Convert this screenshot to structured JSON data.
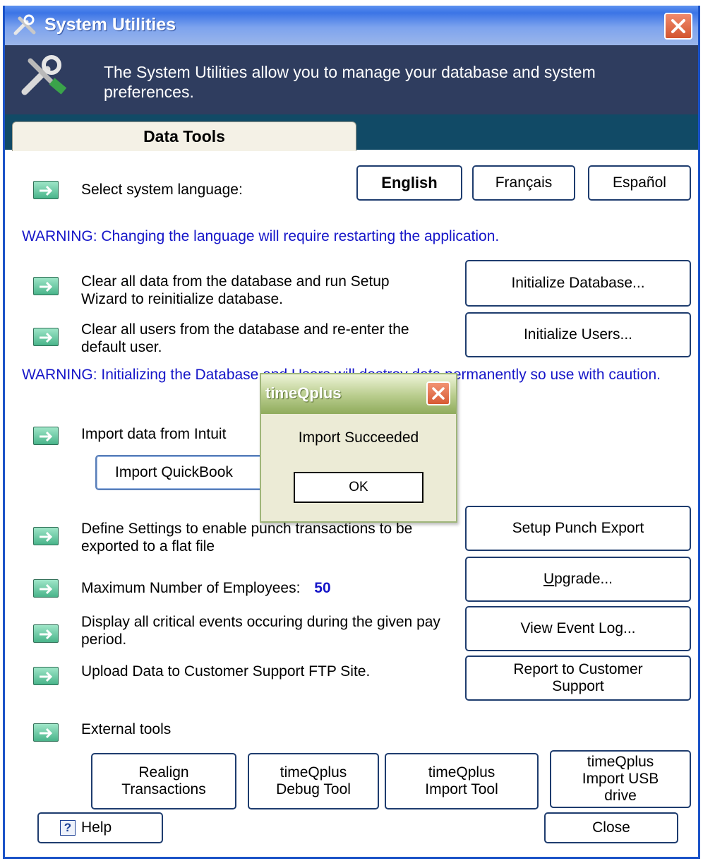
{
  "window": {
    "title": "System Utilities",
    "description": "The System Utilities allow you to manage your database and system preferences."
  },
  "tabs": [
    {
      "label": "Data Tools",
      "active": true
    }
  ],
  "language": {
    "label": "Select system language:",
    "options": [
      "English",
      "Français",
      "Español"
    ],
    "selected": "English"
  },
  "warnings": {
    "language": "WARNING:  Changing the language will require restarting the application.",
    "database": "WARNING:  Initializing the Database and Users will destroy data permanently so use with caution."
  },
  "rows": {
    "clear_data": "Clear all data from the database and run Setup Wizard to reinitialize database.",
    "clear_users": "Clear all users from the  database and re-enter the default user.",
    "import_intuit": "Import data from Intuit",
    "punch_export": "Define Settings to enable punch transactions to be exported to a flat file",
    "max_employees_label": "Maximum Number of Employees:",
    "max_employees_value": "50",
    "critical_events": "Display all critical events occuring during the given pay period.",
    "upload_ftp": "Upload Data to Customer Support FTP Site.",
    "external_tools": "External tools"
  },
  "buttons": {
    "initialize_database": "Initialize Database...",
    "initialize_users": "Initialize Users...",
    "import_quickbooks": "Import QuickBook",
    "setup_punch_export": "Setup Punch Export",
    "upgrade_prefix": "",
    "upgrade_key": "U",
    "upgrade_rest": "pgrade...",
    "view_event_log": "View Event Log...",
    "report_to_support": "Report to Customer Support",
    "realign": "Realign Transactions",
    "debug_tool": "timeQplus Debug Tool",
    "import_tool": "timeQplus Import Tool",
    "import_usb": "timeQplus Import USB drive",
    "help": "Help",
    "close": "Close"
  },
  "dialog": {
    "title": "timeQplus",
    "message": "Import Succeeded",
    "ok": "OK"
  },
  "colors": {
    "titlebar": "#3b74e6",
    "header_band": "#2f3d5f",
    "tab_bar": "#114a66",
    "warning_text": "#1515c8",
    "dialog_bg": "#ecebd6"
  }
}
